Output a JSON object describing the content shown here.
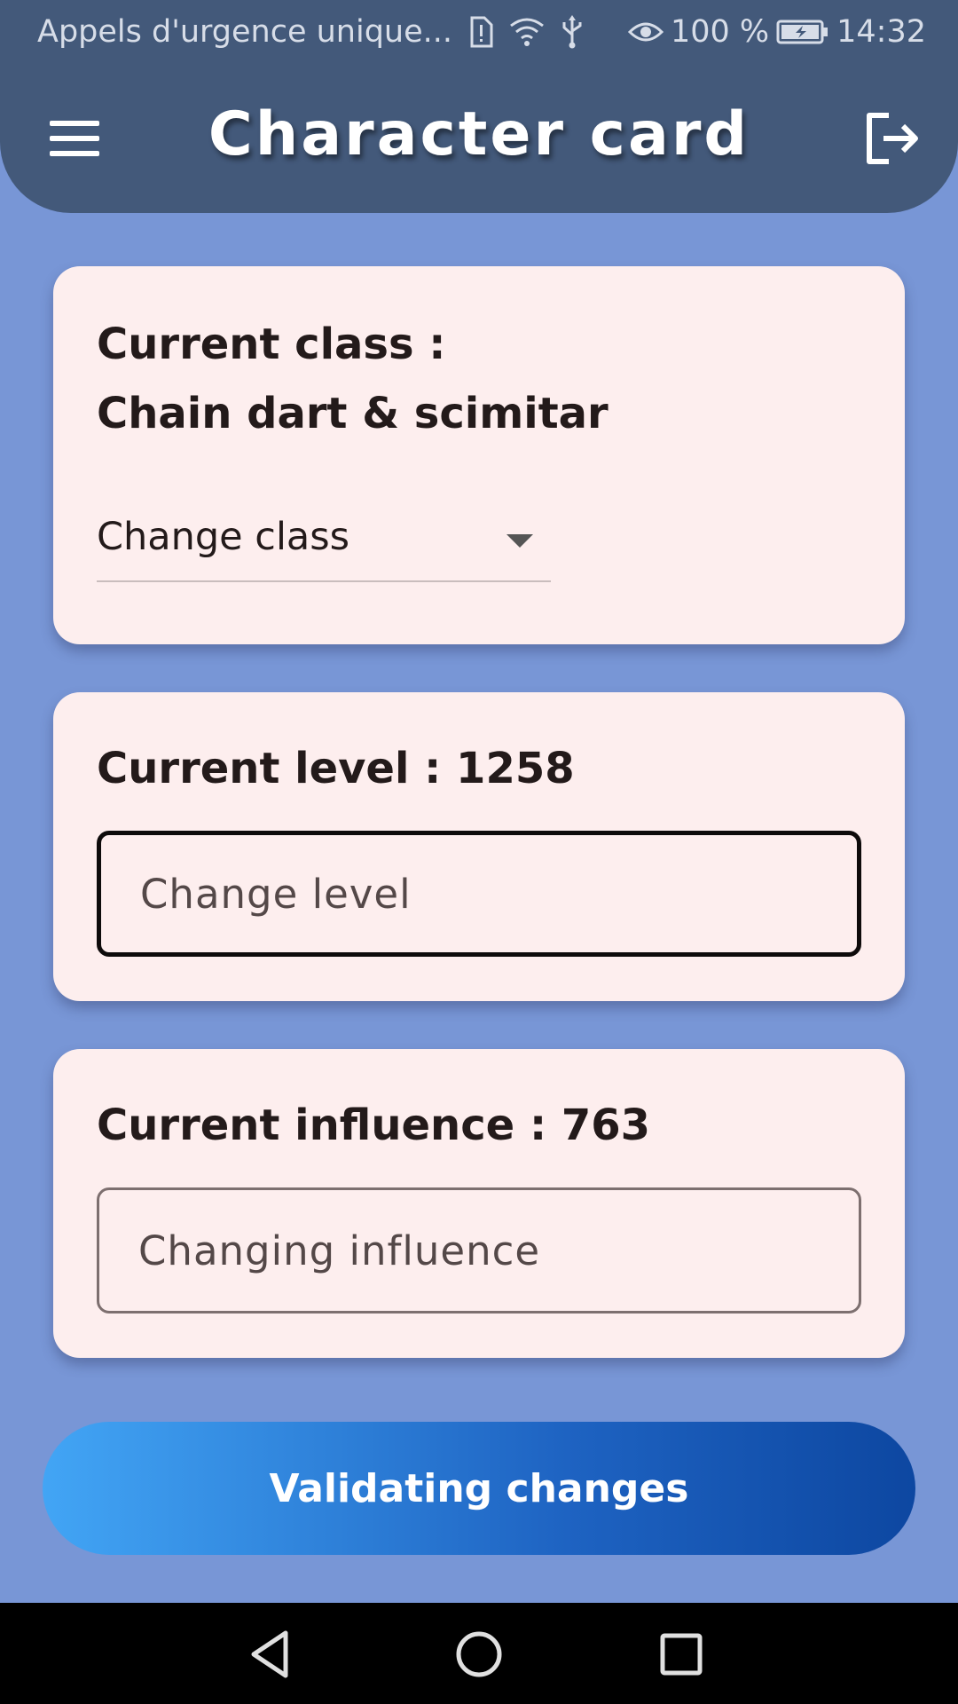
{
  "status_bar": {
    "carrier_text": "Appels d'urgence unique...",
    "battery_percent": "100 %",
    "time": "14:32",
    "icons": [
      "sim-alert-icon",
      "wifi-icon",
      "usb-icon",
      "eye-icon",
      "battery-charging-icon"
    ]
  },
  "app_bar": {
    "title": "Character card",
    "menu_icon": "hamburger-menu-icon",
    "logout_icon": "logout-icon",
    "color": "#43597a"
  },
  "class_card": {
    "label": "Current class :",
    "value": "Chain dart & scimitar",
    "dropdown": {
      "selected": "Change class"
    }
  },
  "level_card": {
    "heading": "Current level : 1258",
    "input_placeholder": "Change level",
    "input_value": ""
  },
  "influence_card": {
    "heading": "Current influence : 763",
    "input_placeholder": "Changing influence",
    "input_value": ""
  },
  "validate_button": {
    "label": "Validating changes",
    "gradient_start": "#42a5f5",
    "gradient_end": "#0d47a1"
  },
  "nav_bar": {
    "icons": [
      "back-triangle-icon",
      "home-circle-icon",
      "recents-square-icon"
    ]
  },
  "colors": {
    "background": "#7896d6",
    "card": "#fdeeee",
    "text": "#231a1a"
  }
}
